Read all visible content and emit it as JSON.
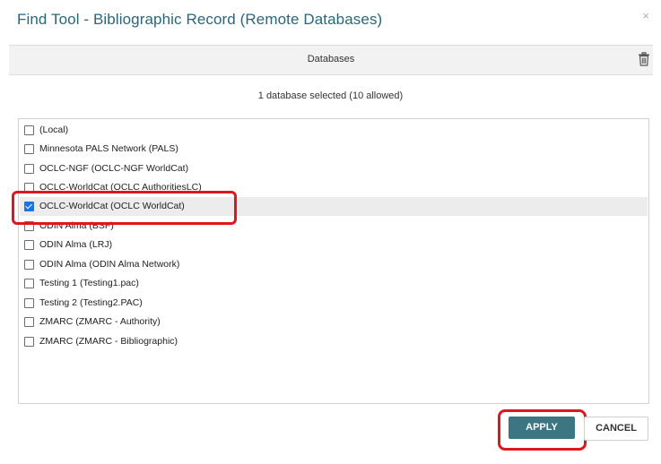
{
  "dialog": {
    "title": "Find Tool - Bibliographic Record (Remote Databases)",
    "close_label": "×"
  },
  "header": {
    "label": "Databases",
    "delete_icon": "trash-icon"
  },
  "selection_summary": "1 database selected (10 allowed)",
  "databases": [
    {
      "label": "(Local)",
      "checked": false
    },
    {
      "label": "Minnesota PALS Network (PALS)",
      "checked": false
    },
    {
      "label": "OCLC-NGF (OCLC-NGF WorldCat)",
      "checked": false
    },
    {
      "label": "OCLC-WorldCat (OCLC AuthoritiesLC)",
      "checked": false
    },
    {
      "label": "OCLC-WorldCat (OCLC WorldCat)",
      "checked": true
    },
    {
      "label": "ODIN Alma (BSF)",
      "checked": false
    },
    {
      "label": "ODIN Alma (LRJ)",
      "checked": false
    },
    {
      "label": "ODIN Alma (ODIN Alma Network)",
      "checked": false
    },
    {
      "label": "Testing 1 (Testing1.pac)",
      "checked": false
    },
    {
      "label": "Testing 2 (Testing2.PAC)",
      "checked": false
    },
    {
      "label": "ZMARC (ZMARC - Authority)",
      "checked": false
    },
    {
      "label": "ZMARC (ZMARC - Bibliographic)",
      "checked": false
    }
  ],
  "buttons": {
    "apply_label": "APPLY",
    "cancel_label": "CANCEL"
  },
  "colors": {
    "title": "#2b6577",
    "apply_bg": "#3c7683",
    "highlight": "#e0161e",
    "checkbox_checked": "#1a73e8"
  }
}
